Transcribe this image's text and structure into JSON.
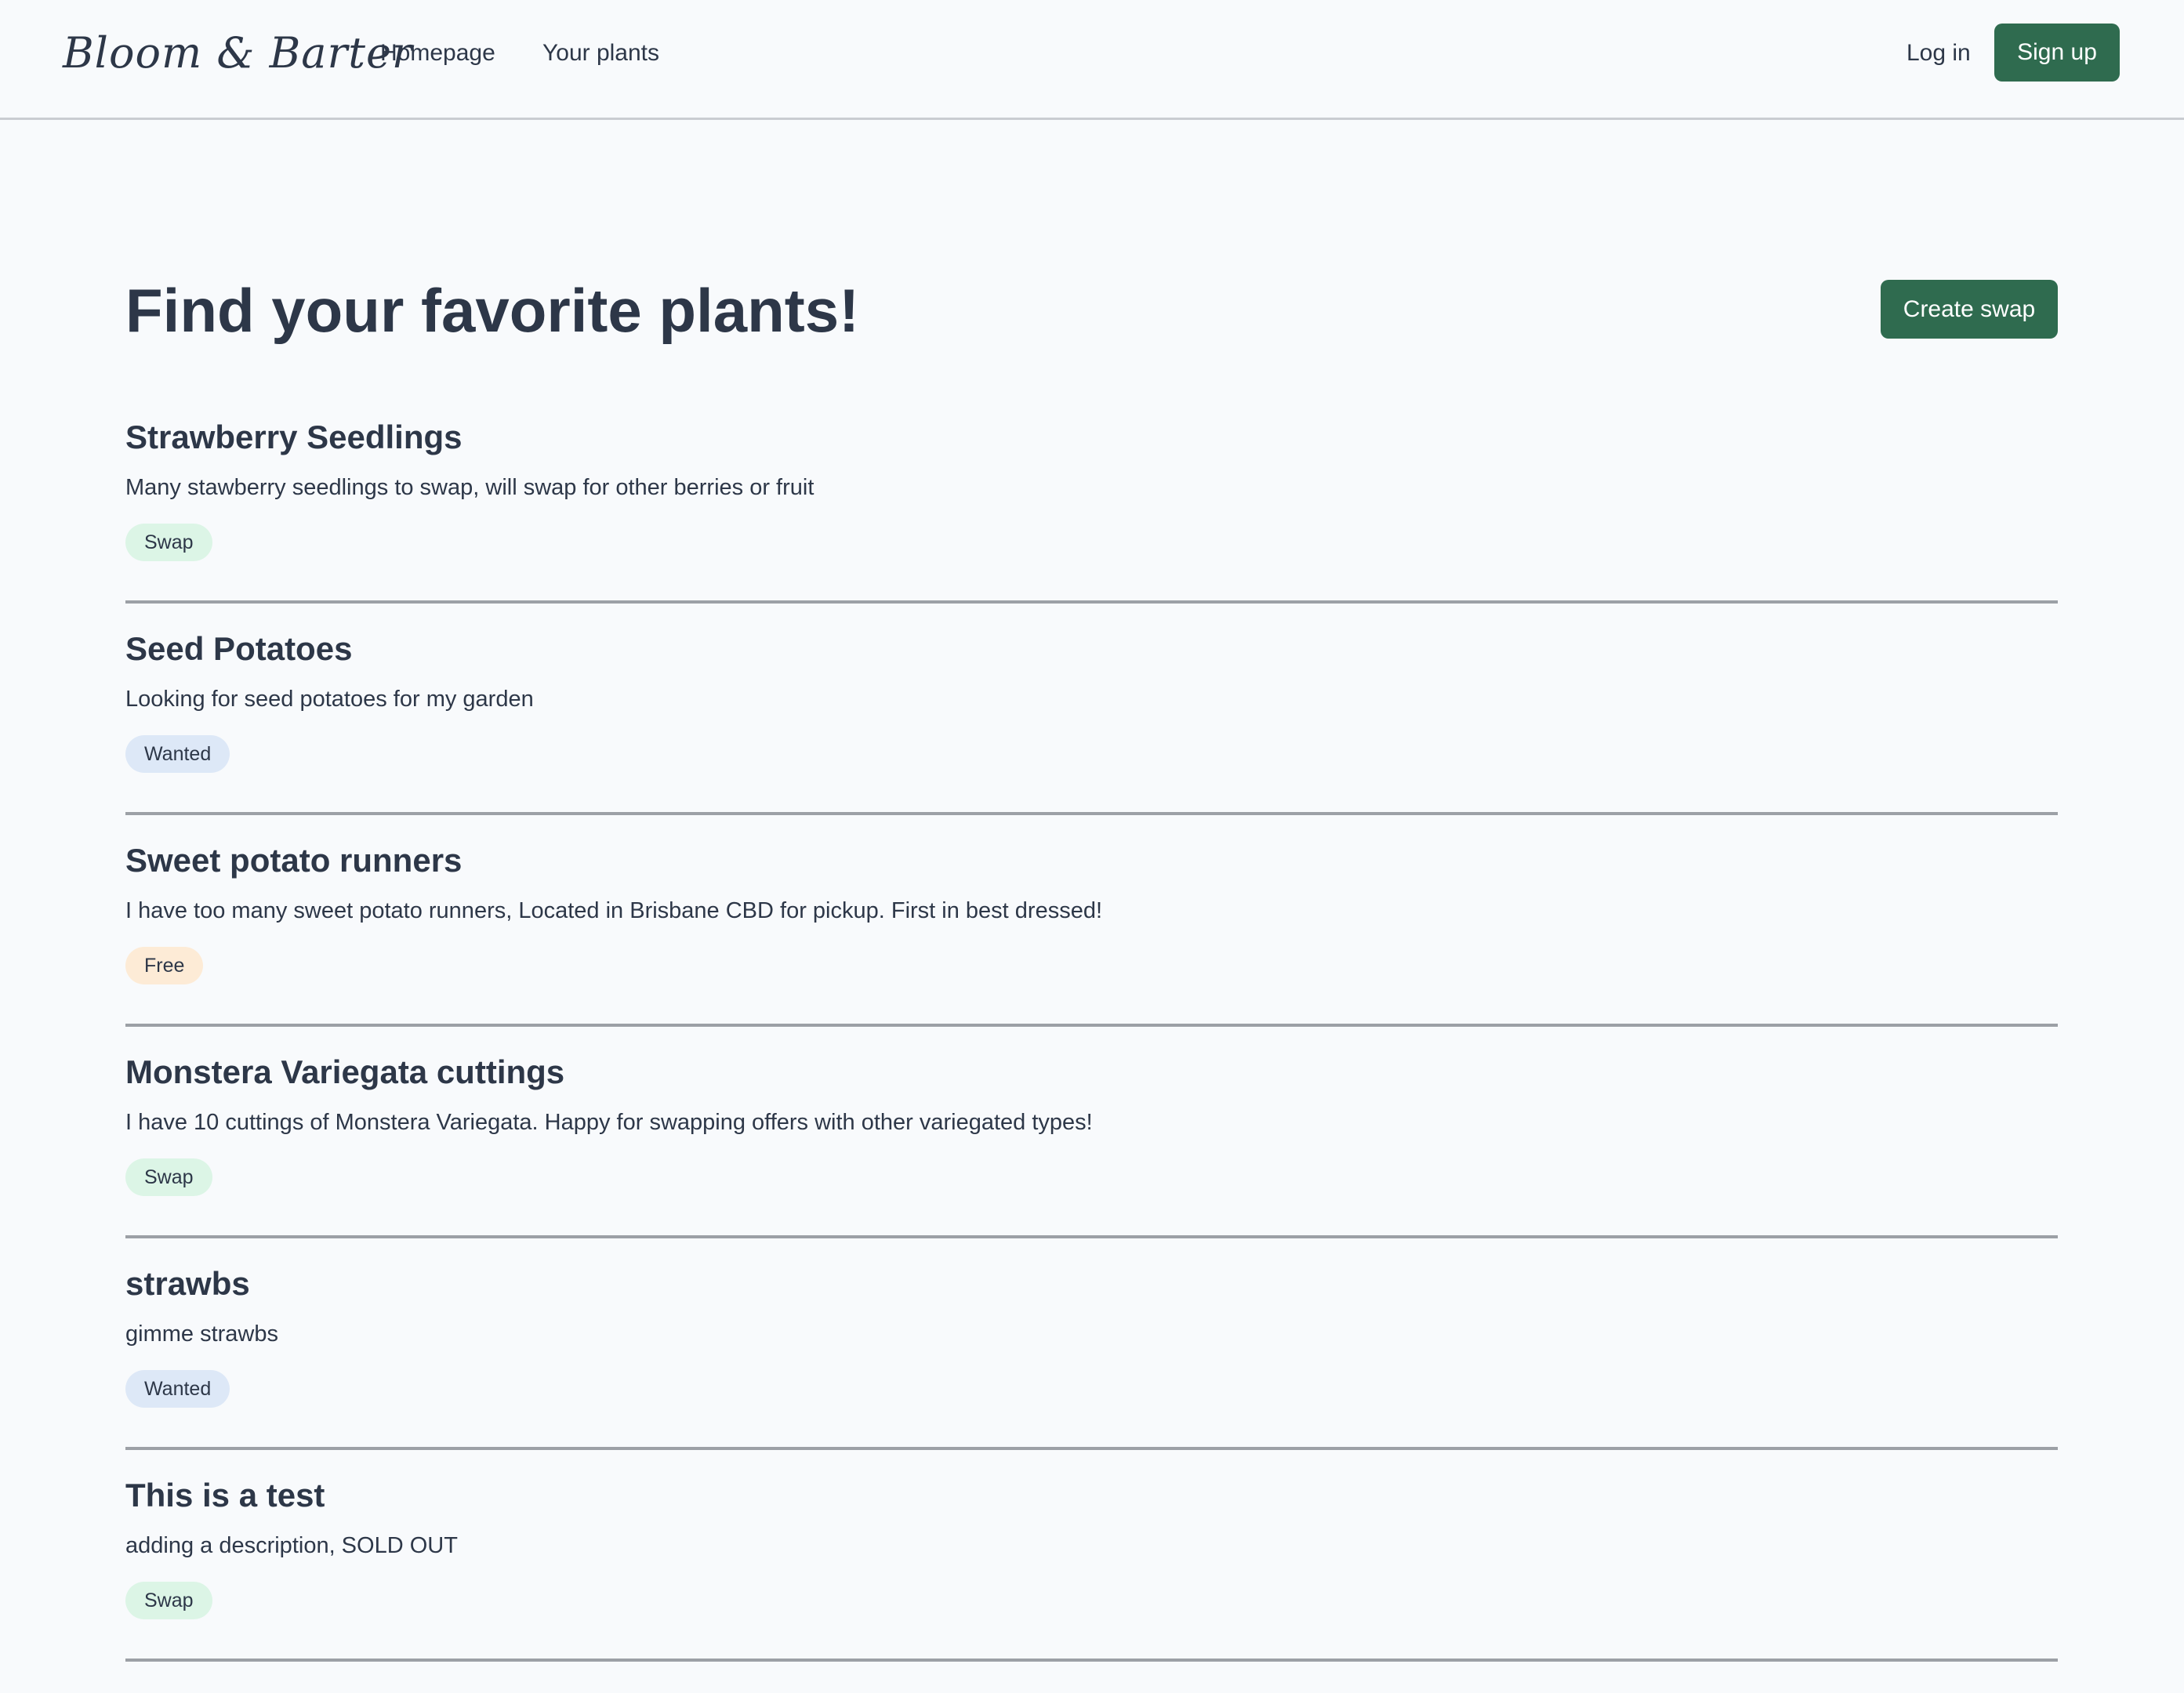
{
  "header": {
    "logo": "Bloom & Barter",
    "nav": [
      {
        "label": "Homepage"
      },
      {
        "label": "Your plants"
      }
    ],
    "login_label": "Log in",
    "signup_label": "Sign up"
  },
  "main": {
    "title": "Find your favorite plants!",
    "create_swap_label": "Create swap",
    "listings": [
      {
        "title": "Strawberry Seedlings",
        "description": "Many stawberry seedlings to swap, will swap for other berries or fruit",
        "badge": "Swap"
      },
      {
        "title": "Seed Potatoes",
        "description": "Looking for seed potatoes for my garden",
        "badge": "Wanted"
      },
      {
        "title": "Sweet potato runners",
        "description": "I have too many sweet potato runners, Located in Brisbane CBD for pickup. First in best dressed!",
        "badge": "Free"
      },
      {
        "title": "Monstera Variegata cuttings",
        "description": "I have 10 cuttings of Monstera Variegata. Happy for swapping offers with other variegated types!",
        "badge": "Swap"
      },
      {
        "title": "strawbs",
        "description": "gimme strawbs",
        "badge": "Wanted"
      },
      {
        "title": "This is a test",
        "description": "adding a description, SOLD OUT",
        "badge": "Swap"
      }
    ]
  },
  "colors": {
    "background": "#f8fafc",
    "text": "#2d3748",
    "primary_button": "#2f6b4f",
    "divider": "#9ca0a6",
    "badge_swap": "#dcf5e6",
    "badge_wanted": "#dde8f7",
    "badge_free": "#fdebd6"
  }
}
